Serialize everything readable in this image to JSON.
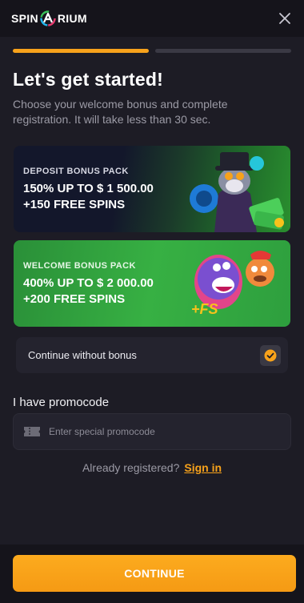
{
  "header": {
    "logo_left": "SPIN",
    "logo_right": "RIUM"
  },
  "progress": {
    "steps": 2,
    "current": 1
  },
  "title": "Let's get started!",
  "subtitle": "Choose your welcome bonus and complete registration. It will take less than 30 sec.",
  "bonuses": [
    {
      "tag": "DEPOSIT BONUS PACK",
      "line1": "150% UP TO $ 1 500.00",
      "line2": "+150 FREE SPINS"
    },
    {
      "tag": "WELCOME BONUS PACK",
      "line1": "400% UP TO $ 2 000.00",
      "line2": "+200 FREE SPINS",
      "art_text": "+FS"
    }
  ],
  "no_bonus": {
    "label": "Continue without bonus",
    "checked": true
  },
  "promo": {
    "title": "I have promocode",
    "placeholder": "Enter special promocode",
    "value": ""
  },
  "registered": {
    "text": "Already registered?",
    "link": "Sign in"
  },
  "continue_label": "CONTINUE",
  "colors": {
    "accent": "#f7a21b",
    "background": "#1d1c25",
    "header": "#15141b"
  }
}
